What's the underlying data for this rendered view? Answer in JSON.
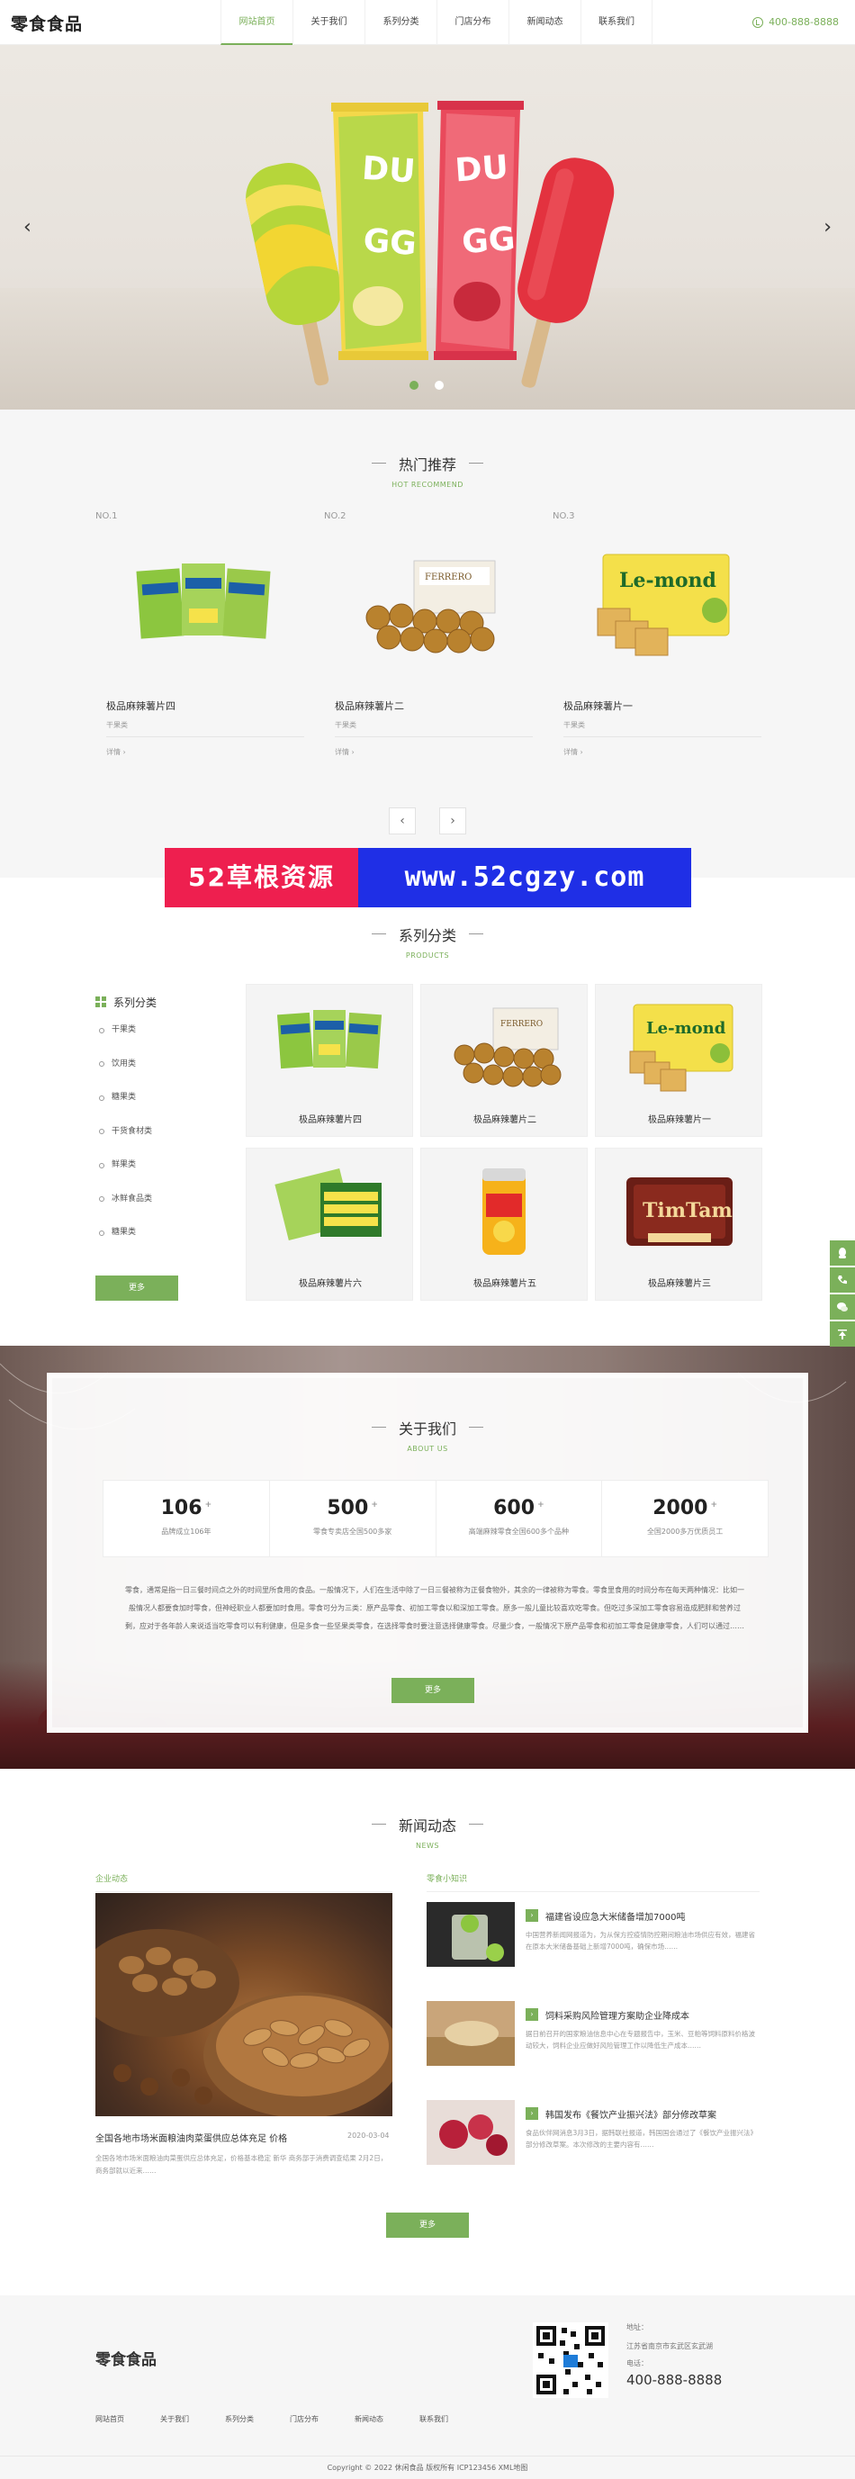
{
  "header": {
    "logo": "零食食品",
    "nav": [
      "网站首页",
      "关于我们",
      "系列分类",
      "门店分布",
      "新闻动态",
      "联系我们"
    ],
    "phone": "400-888-8888"
  },
  "banner": {
    "prev": "‹",
    "next": "›",
    "slides": 2,
    "active_slide": 1
  },
  "hot": {
    "title": "热门推荐",
    "subtitle": "HOT RECOMMEND",
    "items": [
      {
        "no": "NO.1",
        "name": "极品麻辣薯片四",
        "sub": "干果类",
        "more": "详情 ›"
      },
      {
        "no": "NO.2",
        "name": "极品麻辣薯片二",
        "sub": "干果类",
        "more": "详情 ›"
      },
      {
        "no": "NO.3",
        "name": "极品麻辣薯片一",
        "sub": "干果类",
        "more": "详情 ›"
      }
    ],
    "prev": "‹",
    "next": "›"
  },
  "watermark": {
    "left": "52草根资源",
    "right": "www.52cgzy.com"
  },
  "products": {
    "title": "系列分类",
    "subtitle": "PRODUCTS",
    "sidebar_head": "系列分类",
    "categories": [
      "干果类",
      "饮用类",
      "糖果类",
      "干货食材类",
      "鲜果类",
      "冰鲜食品类",
      "糖果类"
    ],
    "more": "更多",
    "items": [
      "极品麻辣薯片四",
      "极品麻辣薯片二",
      "极品麻辣薯片一",
      "极品麻辣薯片六",
      "极品麻辣薯片五",
      "极品麻辣薯片三"
    ]
  },
  "about": {
    "title": "关于我们",
    "subtitle": "ABOUT US",
    "stats": [
      {
        "num": "106",
        "label": "品牌成立106年"
      },
      {
        "num": "500",
        "label": "零食专卖店全国500多家"
      },
      {
        "num": "600",
        "label": "高端麻辣零食全国600多个品种"
      },
      {
        "num": "2000",
        "label": "全国2000多万优质员工"
      }
    ],
    "text": "零食，通常是指一日三餐时间点之外的时间里所食用的食品。一般情况下，人们在生活中除了一日三餐被称为正餐食物外，其余的一律被称为零食。零食里食用的时间分布在每天两种情况：比如一般情况人都要食加时零食，但神经职业人都要加时食用。零食可分为三类：原产品零食、初加工零食以和深加工零食。原多一般儿童比较喜欢吃零食。但吃过多深加工零食容易造成肥胖和营养过剩，应对于各年龄人来说适当吃零食可以有利健康，但是多食一些坚果类零食，在选择零食时要注意选择健康零食。尽量少食，一般情况下原产品零食和初加工零食是健康零食，人们可以通过……",
    "more": "更多"
  },
  "news": {
    "title": "新闻动态",
    "subtitle": "NEWS",
    "left_head": "企业动态",
    "right_head": "零食小知识",
    "feature": {
      "title": "全国各地市场米面粮油肉菜蛋供应总体充足 价格",
      "date": "2020-03-04",
      "desc": "全国各地市场米面粮油肉菜蛋供应总体充足，价格基本稳定 新华 商务部于消费调查结果 2月2日，商务部就以近来……"
    },
    "items": [
      {
        "title": "福建省设应急大米储备增加7000吨",
        "desc": "中国营养新闻网报道为，为从保方控疫情防控期间粮油市场供应有效，福建省在原本大米储备基础上新增7000吨，确保市场……"
      },
      {
        "title": "饲料采购风险管理方案助企业降成本",
        "desc": "据日前召开的国家粮油信息中心在专题报告中，玉米、豆粕等饲料原料价格波动较大，饲料企业应做好风险管理工作以降低生产成本……"
      },
      {
        "title": "韩国发布《餐饮产业振兴法》部分修改草案",
        "desc": "食品伙伴网消息3月3日，据韩联社报道，韩国国会通过了《餐饮产业振兴法》部分修改草案。本次修改的主要内容有……"
      }
    ],
    "more": "更多"
  },
  "footer": {
    "logo": "零食食品",
    "nav": [
      "网站首页",
      "关于我们",
      "系列分类",
      "门店分布",
      "新闻动态",
      "联系我们"
    ],
    "contact_label": "地址：",
    "address": "江苏省南京市玄武区玄武湖",
    "phone_label": "电话：",
    "phone": "400-888-8888",
    "copyright": "Copyright © 2022 休闲食品 版权所有 ICP123456 XML地图"
  },
  "colors": {
    "accent": "#7bb05a",
    "watermark_red": "#ee1f4f",
    "watermark_blue": "#1f2fe6"
  }
}
